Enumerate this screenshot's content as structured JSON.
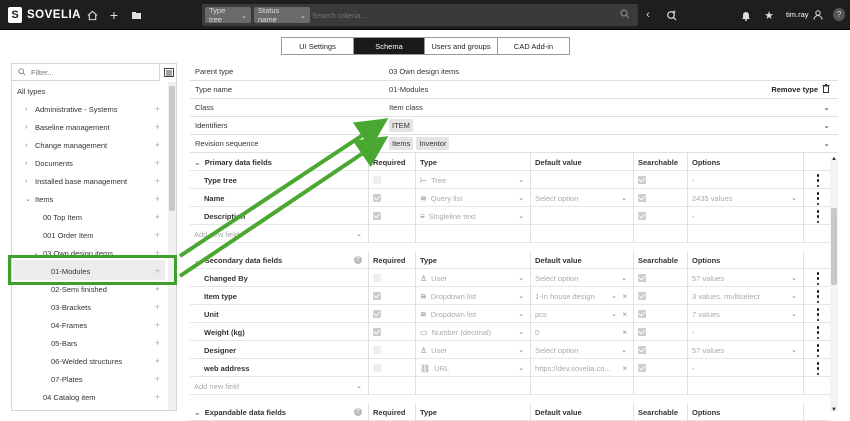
{
  "app": {
    "name": "SOVELIA",
    "user": "tim.ray"
  },
  "topbar": {
    "type_select": "Type tree",
    "name_select": "Status name",
    "search_placeholder": "Search criteria..."
  },
  "tabs": [
    {
      "label": "UI Settings",
      "active": false
    },
    {
      "label": "Schema",
      "active": true
    },
    {
      "label": "Users and groups",
      "active": false
    },
    {
      "label": "CAD Add-in",
      "active": false
    }
  ],
  "sidebar": {
    "filter_placeholder": "Filter...",
    "items": [
      {
        "label": "All types",
        "level": 0,
        "expander": ""
      },
      {
        "label": "Administrative - Systems",
        "level": 1,
        "expander": "›"
      },
      {
        "label": "Baseline management",
        "level": 1,
        "expander": "›"
      },
      {
        "label": "Change management",
        "level": 1,
        "expander": "›"
      },
      {
        "label": "Documents",
        "level": 1,
        "expander": "›"
      },
      {
        "label": "Installed base management",
        "level": 1,
        "expander": "›"
      },
      {
        "label": "Items",
        "level": 1,
        "expander": "⌄"
      },
      {
        "label": "00 Top Item",
        "level": 2,
        "expander": ""
      },
      {
        "label": "001 Order Item",
        "level": 2,
        "expander": ""
      },
      {
        "label": "03 Own design items",
        "level": 2,
        "expander": "⌄"
      },
      {
        "label": "01-Modules",
        "level": 3,
        "expander": ""
      },
      {
        "label": "02-Semi finished",
        "level": 3,
        "expander": ""
      },
      {
        "label": "03-Brackets",
        "level": 3,
        "expander": ""
      },
      {
        "label": "04-Frames",
        "level": 3,
        "expander": ""
      },
      {
        "label": "05-Bars",
        "level": 3,
        "expander": ""
      },
      {
        "label": "06-Welded structures",
        "level": 3,
        "expander": ""
      },
      {
        "label": "07-Plates",
        "level": 3,
        "expander": ""
      },
      {
        "label": "04 Catalog item",
        "level": 2,
        "expander": ""
      }
    ]
  },
  "properties": {
    "parent_type_label": "Parent type",
    "parent_type_value": "03 Own design items",
    "type_name_label": "Type name",
    "type_name_value": "01-Modules",
    "remove_type": "Remove type",
    "class_label": "Class",
    "class_value": "Item class",
    "identifiers_label": "Identifiers",
    "identifiers_chip": "ITEM",
    "revision_label": "Revision sequence",
    "revision_chips": [
      "Items",
      "Inventor"
    ]
  },
  "columns": {
    "required": "Required",
    "type": "Type",
    "default": "Default value",
    "searchable": "Searchable",
    "options": "Options"
  },
  "primary": {
    "title": "Primary data fields",
    "add_new": "Add new field",
    "rows": [
      {
        "name": "Type tree",
        "required": "off",
        "type": "Tree",
        "icon": "tree-icon",
        "glyph": "⊢",
        "default": "",
        "default_dd": false,
        "searchable": "on",
        "options": "-",
        "options_dd": false
      },
      {
        "name": "Name",
        "required": "on",
        "type": "Query list",
        "icon": "layers-icon",
        "glyph": "≋",
        "default": "Select option",
        "default_dd": true,
        "searchable": "on",
        "options": "2435 values",
        "options_dd": true
      },
      {
        "name": "Description",
        "required": "on",
        "type": "Singleline text",
        "icon": "text-lines-icon",
        "glyph": "≡",
        "default": "",
        "default_dd": false,
        "searchable": "on",
        "options": "-",
        "options_dd": false
      }
    ]
  },
  "secondary": {
    "title": "Secondary data fields",
    "add_new": "Add new field",
    "rows": [
      {
        "name": "Changed By",
        "required": "off",
        "type": "User",
        "icon": "user-icon",
        "glyph": "♙",
        "default": "Select option",
        "default_dd": true,
        "default_x": false,
        "searchable": "on",
        "options": "57 values",
        "options_dd": true
      },
      {
        "name": "Item type",
        "required": "on",
        "type": "Dropdown list",
        "icon": "layers-icon",
        "glyph": "≋",
        "default": "1-In house design",
        "default_dd": true,
        "default_x": true,
        "searchable": "on",
        "options": "3 values, multiselect",
        "options_dd": true
      },
      {
        "name": "Unit",
        "required": "on",
        "type": "Dropdown list",
        "icon": "layers-icon",
        "glyph": "≋",
        "default": "pcs",
        "default_dd": true,
        "default_x": true,
        "searchable": "on",
        "options": "7 values",
        "options_dd": true
      },
      {
        "name": "Weight (kg)",
        "required": "on",
        "type": "Number (decimal)",
        "icon": "number-icon",
        "glyph": "▭",
        "default": "0",
        "default_dd": false,
        "default_x": true,
        "searchable": "on",
        "options": "-",
        "options_dd": false
      },
      {
        "name": "Designer",
        "required": "off",
        "type": "User",
        "icon": "user-icon",
        "glyph": "♙",
        "default": "Select option",
        "default_dd": true,
        "default_x": false,
        "searchable": "on",
        "options": "57 values",
        "options_dd": true
      },
      {
        "name": "web address",
        "required": "off",
        "type": "URL",
        "icon": "link-icon",
        "glyph": "⛓",
        "default": "https://dev.sovelia.co...",
        "default_dd": false,
        "default_x": true,
        "searchable": "on",
        "options": "-",
        "options_dd": false
      }
    ]
  },
  "expandable": {
    "title": "Expandable data fields"
  }
}
